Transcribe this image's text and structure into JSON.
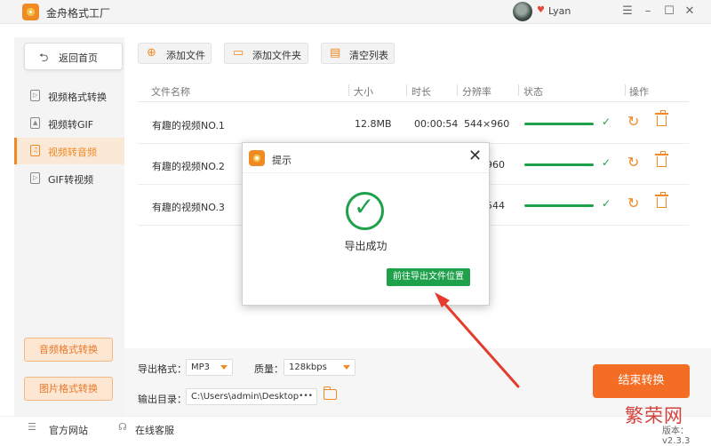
{
  "app": {
    "title": "金舟格式工厂",
    "user_name": "Lyan",
    "window_controls": [
      "menu-icon",
      "minimize-icon",
      "maximize-icon",
      "close-icon"
    ]
  },
  "sidebar": {
    "back_label": "返回首页",
    "items": [
      {
        "label": "视频格式转换",
        "icon": "video-file-icon",
        "active": false
      },
      {
        "label": "视频转GIF",
        "icon": "image-file-icon",
        "active": false
      },
      {
        "label": "视频转音频",
        "icon": "audio-file-icon",
        "active": true
      },
      {
        "label": "GIF转视频",
        "icon": "video-file-icon",
        "active": false
      }
    ],
    "bottom_buttons": [
      "音频格式转换",
      "图片格式转换"
    ]
  },
  "toolbar": {
    "add_file": "添加文件",
    "add_folder": "添加文件夹",
    "clear_list": "清空列表"
  },
  "table": {
    "columns": [
      "文件名称",
      "大小",
      "时长",
      "分辨率",
      "状态",
      "操作"
    ],
    "rows": [
      {
        "name": "有趣的视频NO.1",
        "size": "12.8MB",
        "duration": "00:00:54",
        "resolution": "544×960",
        "progress": 1.0
      },
      {
        "name": "有趣的视频NO.2",
        "size": "",
        "duration": "",
        "resolution": "960",
        "progress": 1.0
      },
      {
        "name": "有趣的视频NO.3",
        "size": "",
        "duration": "",
        "resolution": "544",
        "progress": 1.0
      }
    ]
  },
  "settings": {
    "format_label": "导出格式：",
    "format_value": "MP3",
    "quality_label": "质量：",
    "quality_value": "128kbps",
    "output_label": "输出目录：",
    "output_value": "C:\\Users\\admin\\Desktop\\",
    "output_more": "•••",
    "convert_button": "结束转换"
  },
  "footer": {
    "website": "官方网站",
    "support": "在线客服",
    "version": "版本：v2.3.3"
  },
  "watermark": "繁荣网",
  "dialog": {
    "title": "提示",
    "message": "导出成功",
    "button": "前往导出文件位置"
  },
  "colors": {
    "accent": "#f08a24",
    "success": "#1fa14b",
    "convert": "#f36d25",
    "arrow": "#e53b2c"
  }
}
